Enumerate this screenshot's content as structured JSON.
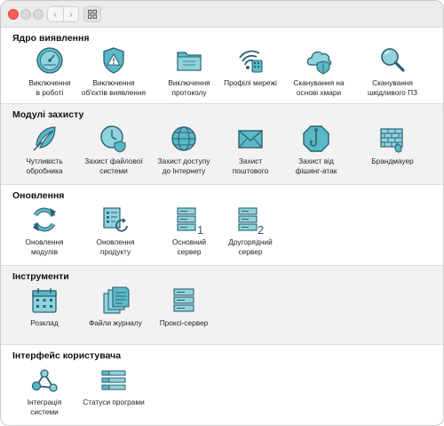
{
  "colors": {
    "icon_fill": "#5ab9c6",
    "icon_stroke": "#2d5f73",
    "accent_red": "#fe5f57"
  },
  "toolbar": {
    "back_icon": "chevron-left-icon",
    "forward_icon": "chevron-right-icon",
    "grid_icon": "grid-view-icon"
  },
  "sections": {
    "core": {
      "title": "Ядро виявлення",
      "items": [
        {
          "label": "Виключення\nв роботі",
          "icon": "gauge-icon"
        },
        {
          "label": "Виключення\nоб'єктів виявлення",
          "icon": "shield-warning-icon"
        },
        {
          "label": "Виключення\nпротоколу",
          "icon": "folder-icon"
        },
        {
          "label": "Профілі мережі",
          "icon": "network-wifi-icon"
        },
        {
          "label": "Сканування на\nоснові хмари",
          "icon": "cloud-shield-icon"
        },
        {
          "label": "Сканування\nшкідливого ПЗ",
          "icon": "magnifier-icon"
        }
      ]
    },
    "protection": {
      "title": "Модулі захисту",
      "items": [
        {
          "label": "Чутливість\nобробника",
          "icon": "feather-icon"
        },
        {
          "label": "Захист файлової\nсистеми",
          "icon": "clock-shield-icon"
        },
        {
          "label": "Захист доступу\nдо Інтернету",
          "icon": "globe-icon"
        },
        {
          "label": "Захист\nпоштового",
          "icon": "envelope-icon"
        },
        {
          "label": "Захист від\nфішинг-атак",
          "icon": "fishhook-icon"
        },
        {
          "label": "Брандмауер",
          "icon": "firewall-icon"
        }
      ]
    },
    "updates": {
      "title": "Оновлення",
      "items": [
        {
          "label": "Оновлення\nмодулів",
          "icon": "refresh-icon"
        },
        {
          "label": "Оновлення\nпродукту",
          "icon": "product-update-icon"
        },
        {
          "label": "Основний\nсервер",
          "icon": "server-primary-icon",
          "badge": "1"
        },
        {
          "label": "Другорядний\nсервер",
          "icon": "server-secondary-icon",
          "badge": "2"
        }
      ]
    },
    "tools": {
      "title": "Інструменти",
      "items": [
        {
          "label": "Розклад",
          "icon": "calendar-icon"
        },
        {
          "label": "Файли журналу",
          "icon": "log-files-icon"
        },
        {
          "label": "Проксі-сервер",
          "icon": "proxy-server-icon"
        }
      ]
    },
    "ui": {
      "title": "Інтерфейс користувача",
      "items": [
        {
          "label": "Інтеграція\nсистеми",
          "icon": "integration-icon"
        },
        {
          "label": "Статуси програми",
          "icon": "app-status-icon"
        }
      ]
    }
  }
}
